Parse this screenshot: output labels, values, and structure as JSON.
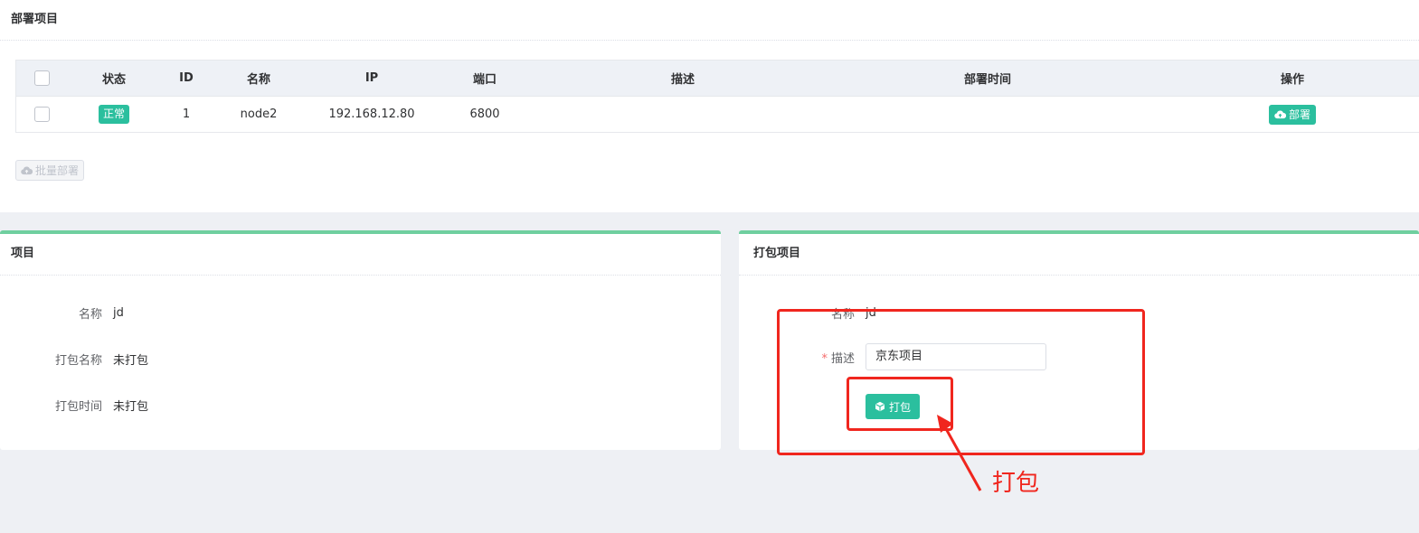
{
  "deploy": {
    "title": "部署项目",
    "columns": [
      "状态",
      "ID",
      "名称",
      "IP",
      "端口",
      "描述",
      "部署时间",
      "操作"
    ],
    "rows": [
      {
        "status": "正常",
        "id": "1",
        "name": "node2",
        "ip": "192.168.12.80",
        "port": "6800",
        "desc": "",
        "time": "",
        "action": "部署"
      }
    ],
    "batch_label": "批量部署"
  },
  "project": {
    "title": "项目",
    "fields": [
      {
        "label": "名称",
        "value": "jd"
      },
      {
        "label": "打包名称",
        "value": "未打包"
      },
      {
        "label": "打包时间",
        "value": "未打包"
      }
    ]
  },
  "package": {
    "title": "打包项目",
    "name_label": "名称",
    "name_value": "jd",
    "desc_required": "*",
    "desc_label": "描述",
    "desc_value": "京东项目",
    "button_label": "打包"
  },
  "annotation": {
    "text": "打包",
    "color": "#f0261e"
  },
  "colors": {
    "accent": "#2bbf9e",
    "panel_top_border": "#6fcf9f"
  },
  "icons": {
    "deploy": "cloud-upload-icon",
    "pack": "cube-icon"
  }
}
